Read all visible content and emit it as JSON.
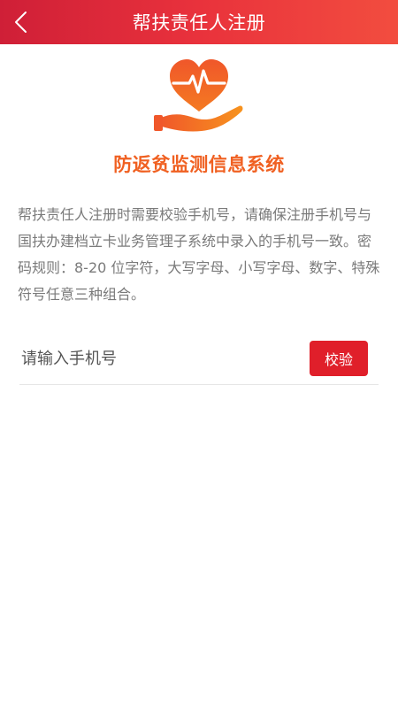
{
  "header": {
    "title": "帮扶责任人注册",
    "back_icon": "chevron-left-icon",
    "background_colors": [
      "#cf1f37",
      "#f24d3f"
    ]
  },
  "logo": {
    "icon": "heart-pulse-hand-icon",
    "colors": [
      "#f0572a",
      "#f7931e"
    ]
  },
  "app_name": "防返贫监测信息系统",
  "notice": "帮扶责任人注册时需要校验手机号，请确保注册手机号与国扶办建档立卡业务管理子系统中录入的手机号一致。密码规则：8-20 位字符，大写字母、小写字母、数字、特殊符号任意三种组合。",
  "phone_form": {
    "placeholder": "请输入手机号",
    "value": "",
    "verify_label": "校验",
    "verify_color": "#e01f2a"
  }
}
